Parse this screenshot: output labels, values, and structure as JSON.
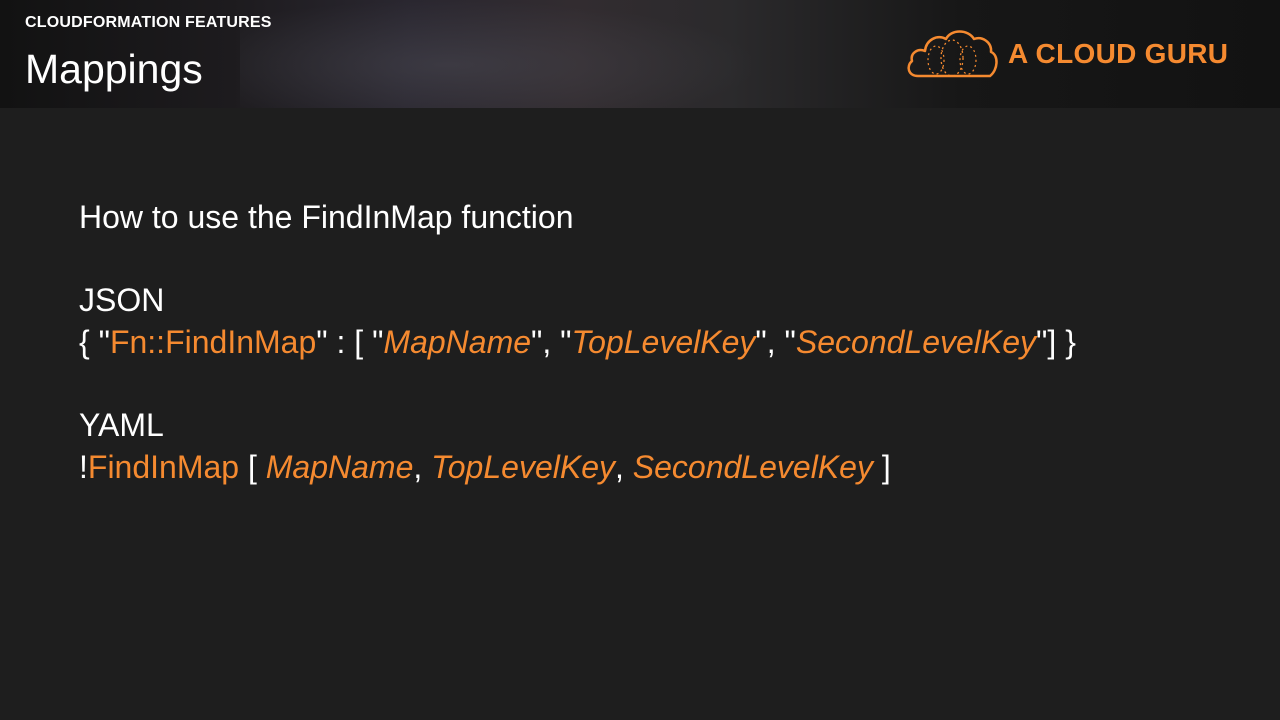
{
  "header": {
    "eyebrow": "CLOUDFORMATION FEATURES",
    "title": "Mappings",
    "logo_text": "A CLOUD GURU",
    "logo_icon": "cloud-icon"
  },
  "colors": {
    "background": "#1e1e1e",
    "accent": "#f58a30",
    "text": "#ffffff"
  },
  "content": {
    "heading": "How to use the FindInMap function",
    "json": {
      "label": "JSON",
      "brace_open": "{ \"",
      "fn": "Fn::FindInMap",
      "sep1": "\" : [ \"",
      "arg1": "MapName",
      "sep2": "\", \"",
      "arg2": "TopLevelKey",
      "sep3": "\", \"",
      "arg3": "SecondLevelKey",
      "close": "\"] }"
    },
    "yaml": {
      "label": "YAML",
      "bang": "!",
      "fn": "FindInMap",
      "open": " [ ",
      "arg1": "MapName",
      "comma1": ", ",
      "arg2": "TopLevelKey",
      "comma2": ", ",
      "arg3": "SecondLevelKey",
      "close": " ]"
    }
  }
}
